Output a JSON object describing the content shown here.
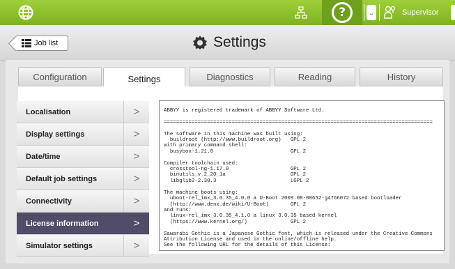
{
  "topbar": {
    "globe_icon": "globe-icon",
    "network_icon": "network-icon",
    "help_icon": "help-icon",
    "user_icon": "user-key-icon",
    "user_label": "Supervisor",
    "colors": {
      "bar": "#8cc12c",
      "dark": "#6fa01c"
    }
  },
  "header": {
    "job_list_label": "Job list",
    "title": "Settings"
  },
  "tabs": [
    {
      "label": "Configuration"
    },
    {
      "label": "Settings"
    },
    {
      "label": "Diagnostics"
    },
    {
      "label": "Reading"
    },
    {
      "label": "History"
    }
  ],
  "sidebar": {
    "items": [
      {
        "label": "Localisation"
      },
      {
        "label": "Display settings"
      },
      {
        "label": "Date/time"
      },
      {
        "label": "Default job settings"
      },
      {
        "label": "Connectivity"
      },
      {
        "label": "License information"
      },
      {
        "label": "Simulator settings"
      }
    ],
    "active_color": "#4f4d68"
  },
  "license": {
    "text": "ABBYY is registered trademark of ABBYY Software Ltd.\n\n=======================================================================================\n\nThe software in this machine was built using:\n  buildroot (http://www.buildroot.org)   GPL 2\nwith primary command shell:\n  busybox-1.21.0                         GPL 2\n\nCompiler toolchain used:\n  crosstool-ng-1.17.0                    GPL 2\n  binutils_v_2_20_1a                     GPL 2\n  libglib2-2.30.3                        LGPL 2\n\nThe machine boots using:\n  uboot-rel_imx_3.0.35_4.0.0 a U-Boot 2009.08-00652-g4766072 based bootloader\n  (http://www.denx.de/wiki/U-Boot)       GPL 2\nand runs:\n  linux-rel_imx_3.0.35_4.1.0 a linux 3.0.35 based kernel\n  (https://www.kernel.org/)              GPL 2\n\nSawarabi Gothic is a Japanese Gothic font, which is released under the Creative Commons\nAttribution License and used in the online/offline help.\nSee the following URL for the details of this License:"
  }
}
